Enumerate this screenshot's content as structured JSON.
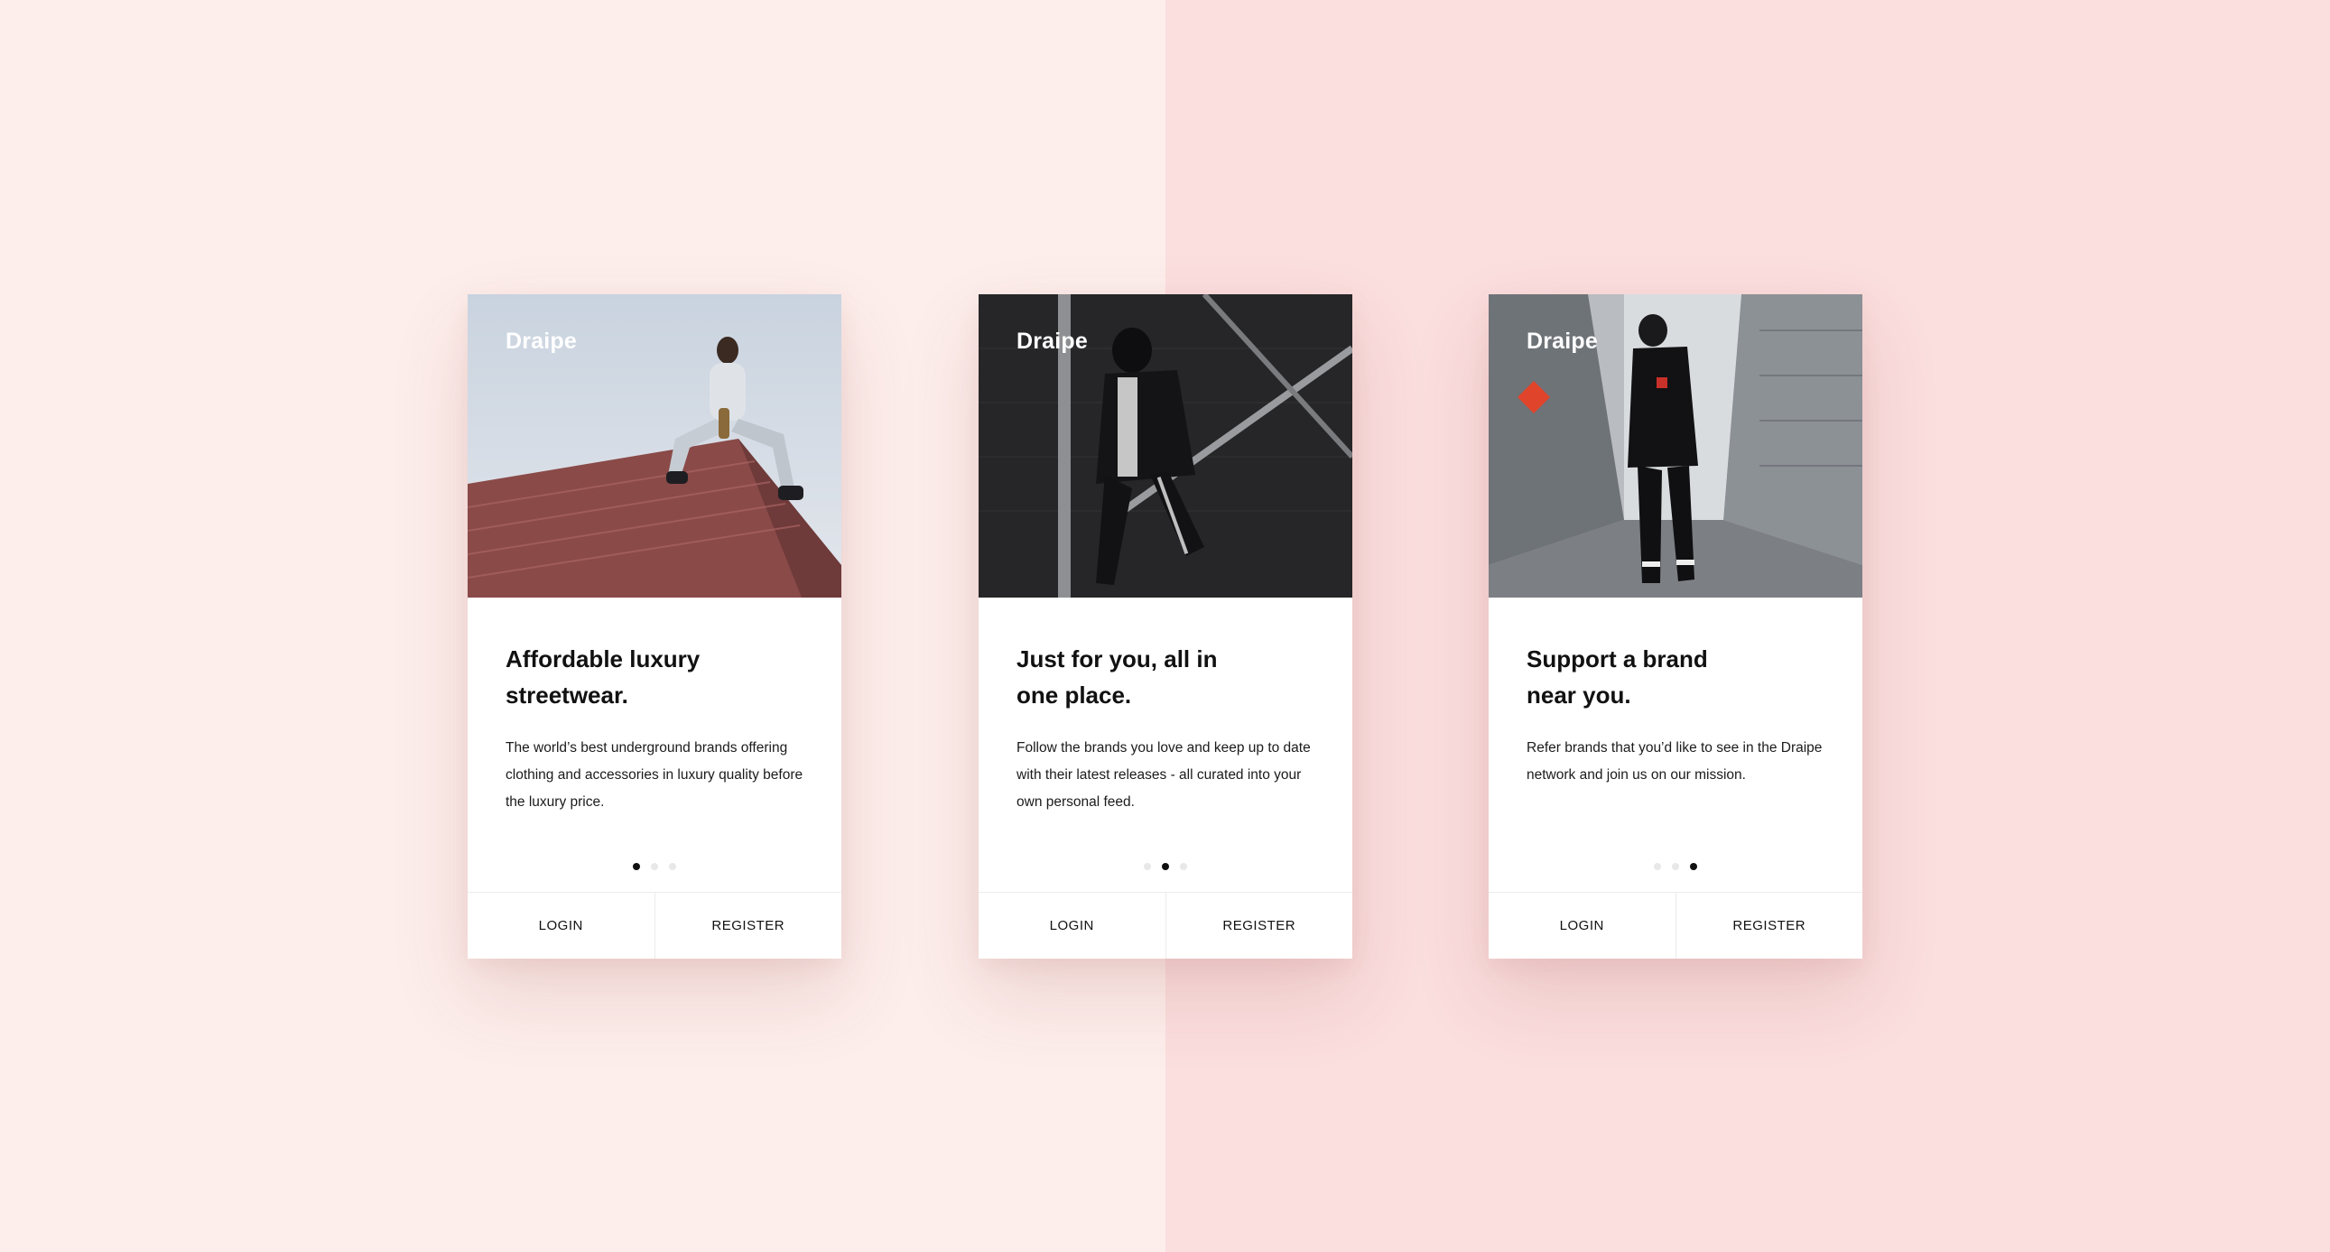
{
  "colors": {
    "background_left": "#fdeeeb",
    "background_right": "#fbdede",
    "card": "#ffffff",
    "text": "#111111",
    "dot_active": "#111111",
    "dot_inactive": "#e8e8e8"
  },
  "cards": [
    {
      "brand": "Draipe",
      "headline": "Affordable luxury streetwear.",
      "description": "The world’s best underground brands offering clothing and accessories in luxury quality before the luxury price.",
      "active_page": 1,
      "page_count": 3,
      "login_label": "LOGIN",
      "register_label": "REGISTER"
    },
    {
      "brand": "Draipe",
      "headline": "Just for you, all in one place.",
      "description": "Follow the brands you love and keep up to date with their latest releases - all curated into your own personal feed.",
      "active_page": 2,
      "page_count": 3,
      "login_label": "LOGIN",
      "register_label": "REGISTER"
    },
    {
      "brand": "Draipe",
      "headline": "Support a brand near you.",
      "description": "Refer brands that you’d like to see in the Draipe network and join us on our mission.",
      "active_page": 3,
      "page_count": 3,
      "login_label": "LOGIN",
      "register_label": "REGISTER"
    }
  ]
}
